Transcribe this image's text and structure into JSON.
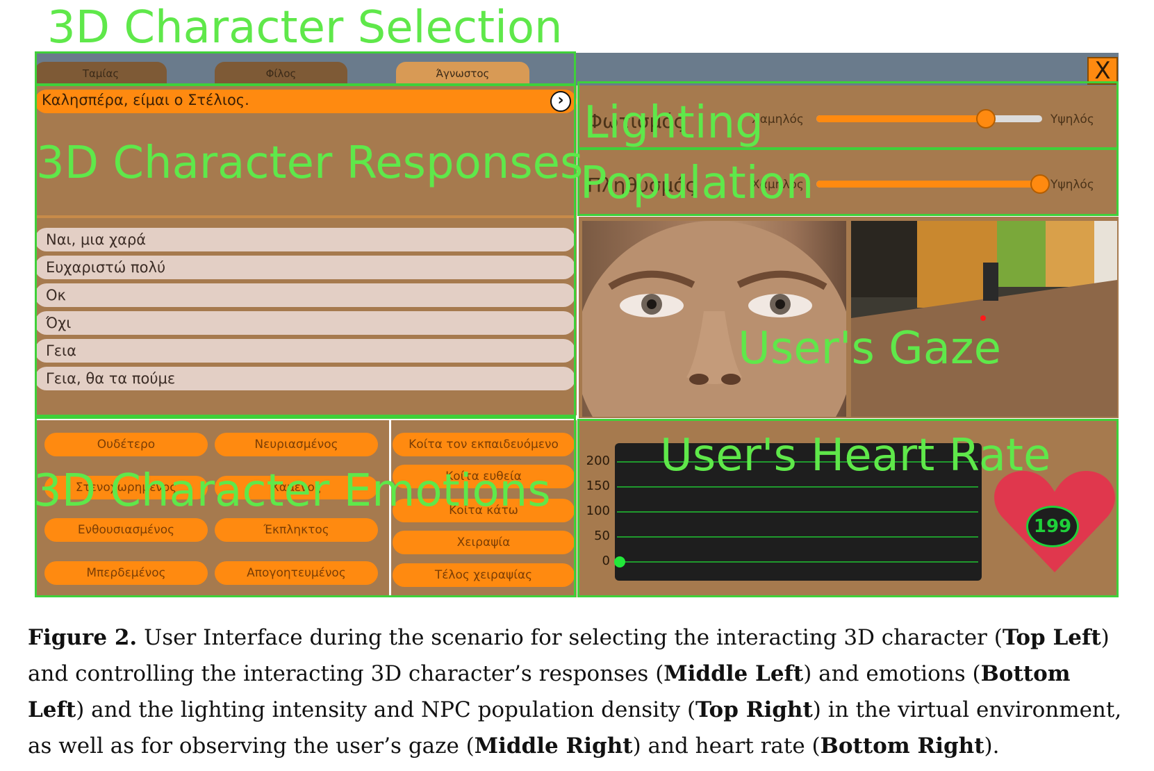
{
  "annotations": {
    "selection": "3D Character Selection",
    "responses": "3D Character Responses",
    "emotions": "3D Character Emotions",
    "lighting": "Lighting",
    "population": "Population",
    "gaze": "User's Gaze",
    "heart_rate": "User's Heart Rate"
  },
  "tabs": [
    {
      "label": "Ταμίας",
      "active": false
    },
    {
      "label": "Φίλος",
      "active": false
    },
    {
      "label": "Άγνωστος",
      "active": true
    }
  ],
  "close_label": "X",
  "dialogue": {
    "text": "Καλησπέρα, είμαι ο Στέλιος.",
    "next_icon": "chevron-right-icon"
  },
  "responses": [
    "Ναι, μια χαρά",
    "Ευχαριστώ πολύ",
    "Οκ",
    "Όχι",
    "Γεια",
    "Γεια, θα τα πούμε"
  ],
  "emotions": [
    [
      "Ουδέτερο",
      "Νευριασμένος"
    ],
    [
      "Στενοχωρημένος",
      "Χαμένος"
    ],
    [
      "Ενθουσιασμένος",
      "Έκπληκτος"
    ],
    [
      "Μπερδεμένος",
      "Απογοητευμένος"
    ]
  ],
  "gestures": [
    "Κοίτα τον εκπαιδευόμενο",
    "Κοίτα ευθεία",
    "Κοίτα κάτω",
    "Χειραψία",
    "Τέλος χειραψίας"
  ],
  "lighting": {
    "label": "Φωτισμός",
    "min_label": "Χαμηλός",
    "max_label": "Υψηλός",
    "level": 0.75
  },
  "population": {
    "label": "Πληθυσμός",
    "min_label": "Χαμηλός",
    "max_label": "Υψηλός",
    "level": 0.99
  },
  "heart_chart": {
    "y_ticks": [
      "200",
      "150",
      "100",
      "50",
      "0"
    ],
    "current_bpm": "199"
  },
  "colors": {
    "panel": "#a67a4e",
    "accent": "#ff8a10",
    "annotation": "#5fe84a",
    "heart": "#e0374d"
  },
  "caption": {
    "label": "Figure 2.",
    "text_1": " User Interface during the scenario for selecting the interacting 3D character (",
    "bold_1": "Top Left",
    "text_2": ") and controlling the interacting 3D character’s responses (",
    "bold_2": "Middle Left",
    "text_3": ") and emotions (",
    "bold_3": "Bottom Left",
    "text_4": ") and the lighting intensity and NPC population density (",
    "bold_4": "Top Right",
    "text_5": ") in the virtual environment, as well as for observing the user’s gaze (",
    "bold_5": "Middle Right",
    "text_6": ") and heart rate (",
    "bold_6": "Bottom Right",
    "text_7": ")."
  }
}
